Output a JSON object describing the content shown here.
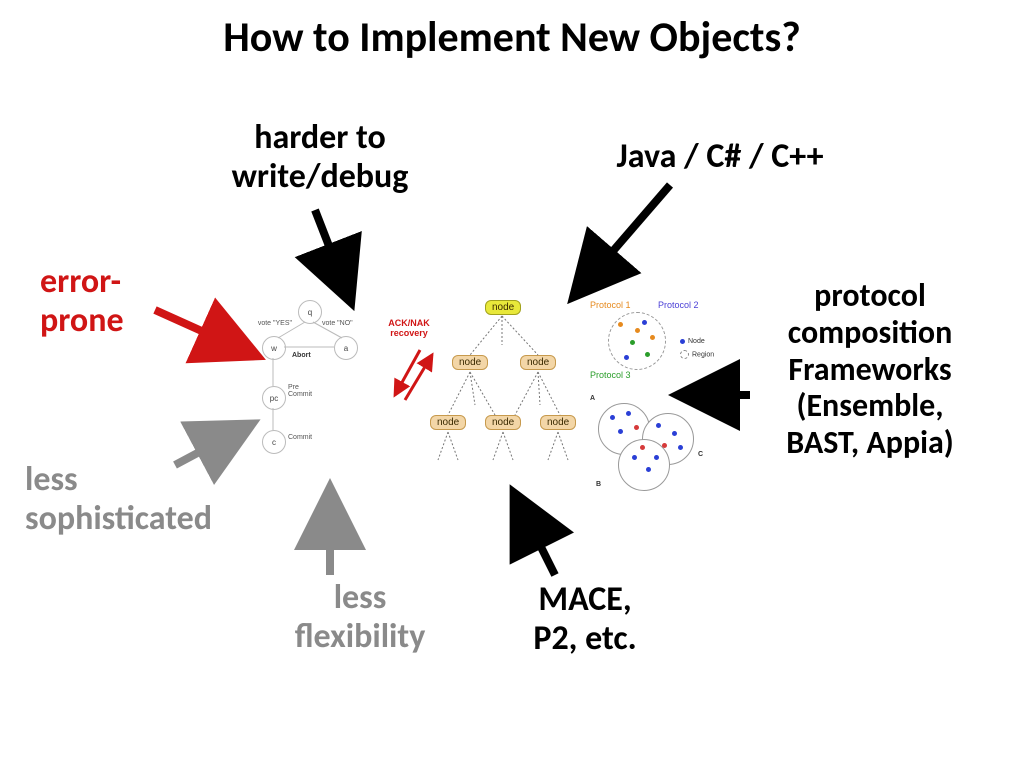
{
  "title": "How to Implement New Objects?",
  "labels": {
    "harder": "harder to\nwrite/debug",
    "java": "Java / C# / C++",
    "error": "error-\nprone",
    "lessSoph": "less\nsophisticated",
    "lessFlex": "less\nflexibility",
    "mace": "MACE,\nP2, etc.",
    "protocol": "protocol\ncomposition\nFrameworks\n(Ensemble,\nBAST, Appia)"
  },
  "colors": {
    "black": "#000000",
    "red": "#d01515",
    "gray": "#8a8a8a"
  },
  "collage": {
    "state": {
      "q": "q",
      "w": "w",
      "a": "a",
      "pc": "pc",
      "c": "c",
      "abort": "Abort",
      "voteYes": "vote \"YES\"",
      "voteNo": "vote \"NO\"",
      "preCommit": "Pre\nCommit",
      "commit": "Commit"
    },
    "ack": "ACK/NAK\nrecovery",
    "node": "node",
    "prot": {
      "p1": "Protocol 1",
      "p2": "Protocol 2",
      "p3": "Protocol 3"
    },
    "legend": {
      "node": "Node",
      "region": "Region"
    },
    "venn": {
      "a": "A",
      "b": "B",
      "c": "C"
    }
  }
}
